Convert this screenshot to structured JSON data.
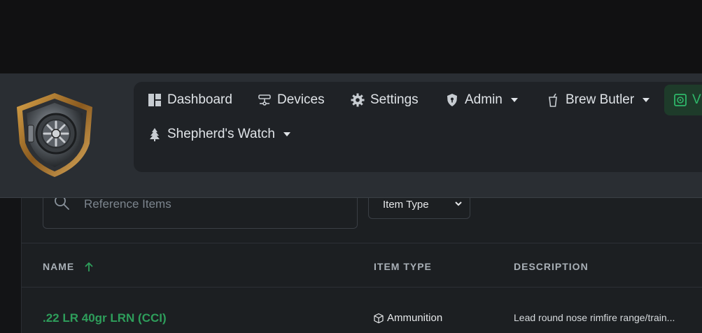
{
  "header": {
    "nav": {
      "dashboard": "Dashboard",
      "devices": "Devices",
      "settings": "Settings",
      "admin": "Admin",
      "brew_butler": "Brew Butler",
      "shepherds_watch": "Shepherd's Watch",
      "cut_off_item": "V"
    }
  },
  "filters": {
    "search_placeholder": "Reference Items",
    "item_type_select": "Item Type"
  },
  "table": {
    "columns": {
      "name": "NAME",
      "item_type": "ITEM TYPE",
      "description": "DESCRIPTION"
    },
    "sort": {
      "column": "name",
      "direction": "ascending"
    },
    "rows": [
      {
        "name": ".22 LR 40gr LRN (CCI)",
        "item_type": "Ammunition",
        "description": "Lead round nose rimfire range/train..."
      }
    ]
  },
  "colors": {
    "accent_green": "#2e9e5b",
    "header_bg": "#2a2e33",
    "nav_panel_bg": "#1f2226",
    "page_bg": "#111112"
  },
  "icons": {
    "logo": "vault-shield-logo",
    "dashboard": "dashboard-icon",
    "devices": "devices-icon",
    "settings": "gear-icon",
    "admin": "shield-icon",
    "brew_butler": "cup-icon",
    "shepherds_watch": "tree-icon",
    "search": "search-icon",
    "sort": "arrow-up-icon",
    "item_type": "box-icon"
  }
}
